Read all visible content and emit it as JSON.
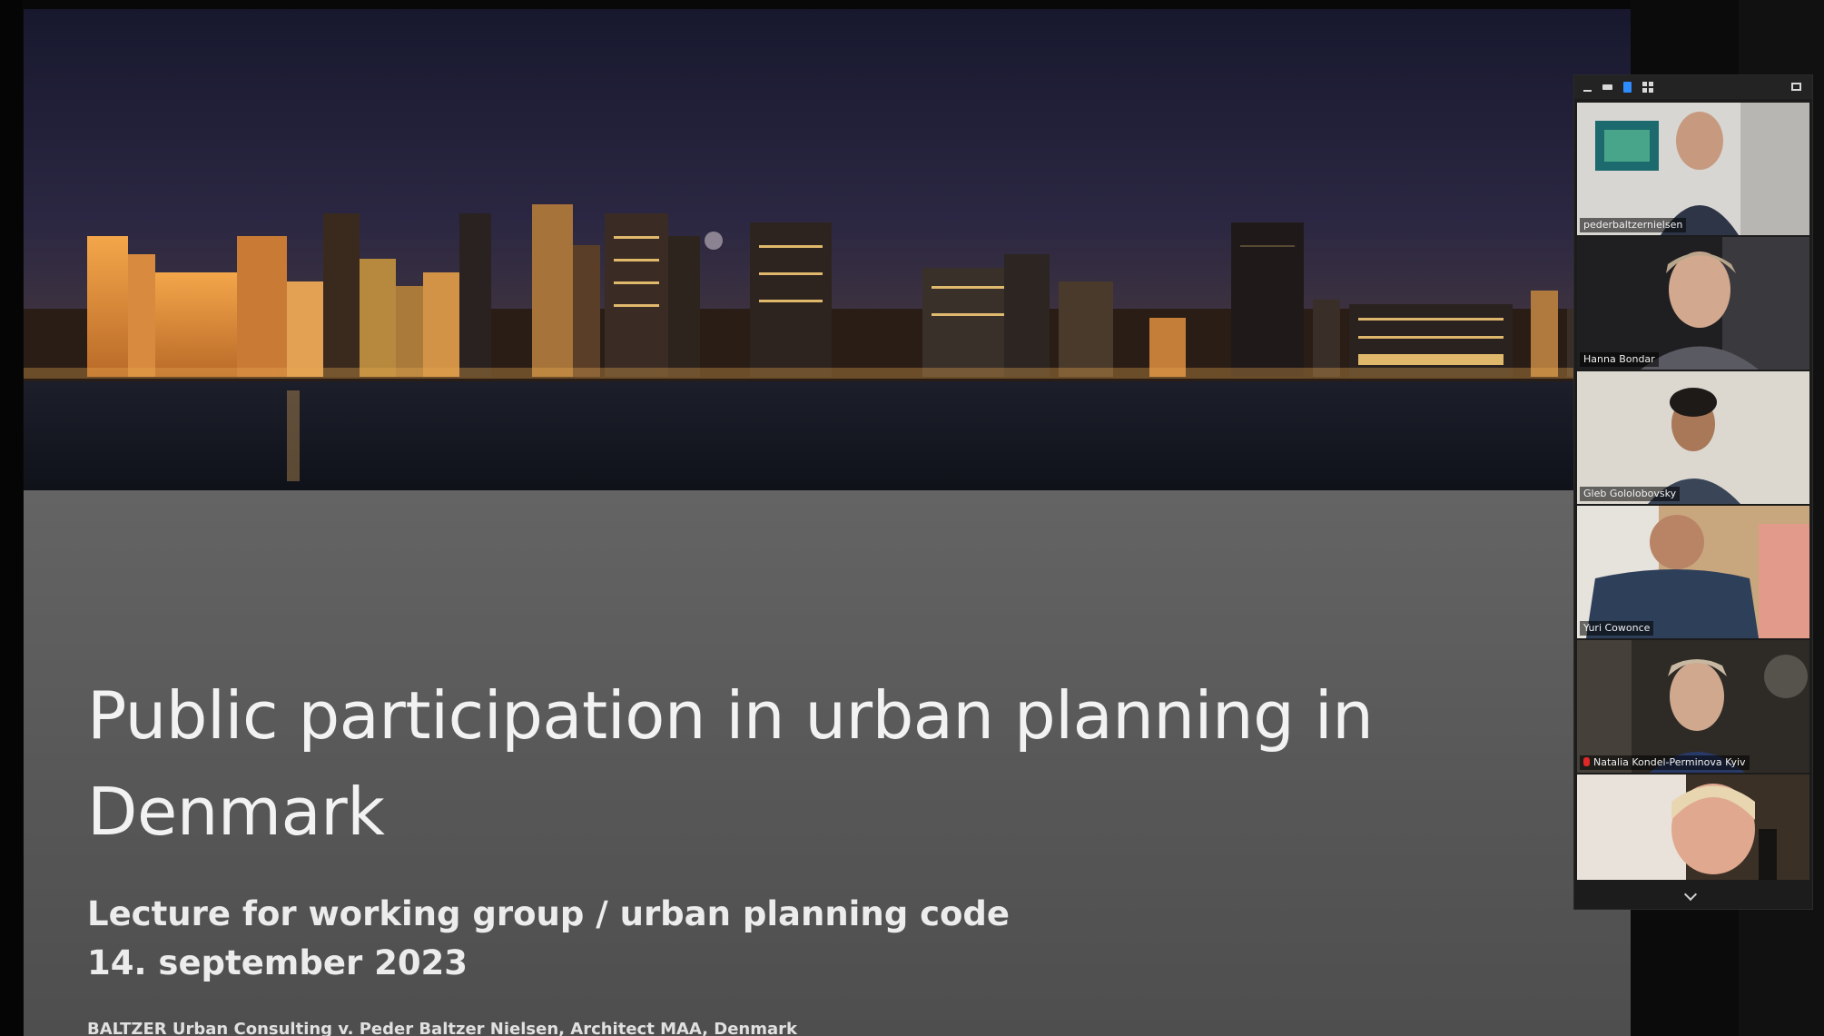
{
  "slide": {
    "title_line1": "Public participation in urban planning in",
    "title_line2": "Denmark",
    "subtitle_line1": "Lecture for working group / urban planning code",
    "subtitle_line2": "14. september 2023",
    "footer": "BALTZER Urban Consulting v. Peder Baltzer Nielsen, Architect MAA, Denmark",
    "hero_image": "night-city-skyline-waterfront"
  },
  "participants_panel": {
    "toolbar_icons": [
      "minimize-icon",
      "strip-view-icon",
      "speaker-view-icon",
      "gallery-view-icon",
      "exit-fullscreen-icon"
    ],
    "participants": [
      {
        "name": "pederbaltzernielsen",
        "muted": false,
        "active": false
      },
      {
        "name": "Hanna Bondar",
        "muted": false,
        "active": true
      },
      {
        "name": "Gleb Gololobovsky",
        "muted": false,
        "active": false
      },
      {
        "name": "Yuri Cowonce",
        "muted": false,
        "active": false
      },
      {
        "name": "Natalia Kondel-Perminova Kyiv",
        "muted": true,
        "active": false
      },
      {
        "name": "",
        "muted": false,
        "active": false
      }
    ],
    "scroll_icon": "chevron-down-icon"
  },
  "colors": {
    "active_speaker_border": "#9ad443",
    "muted_mic": "#e02828",
    "view_highlight": "#2d8cff",
    "slide_background": "#5a5a5a"
  }
}
